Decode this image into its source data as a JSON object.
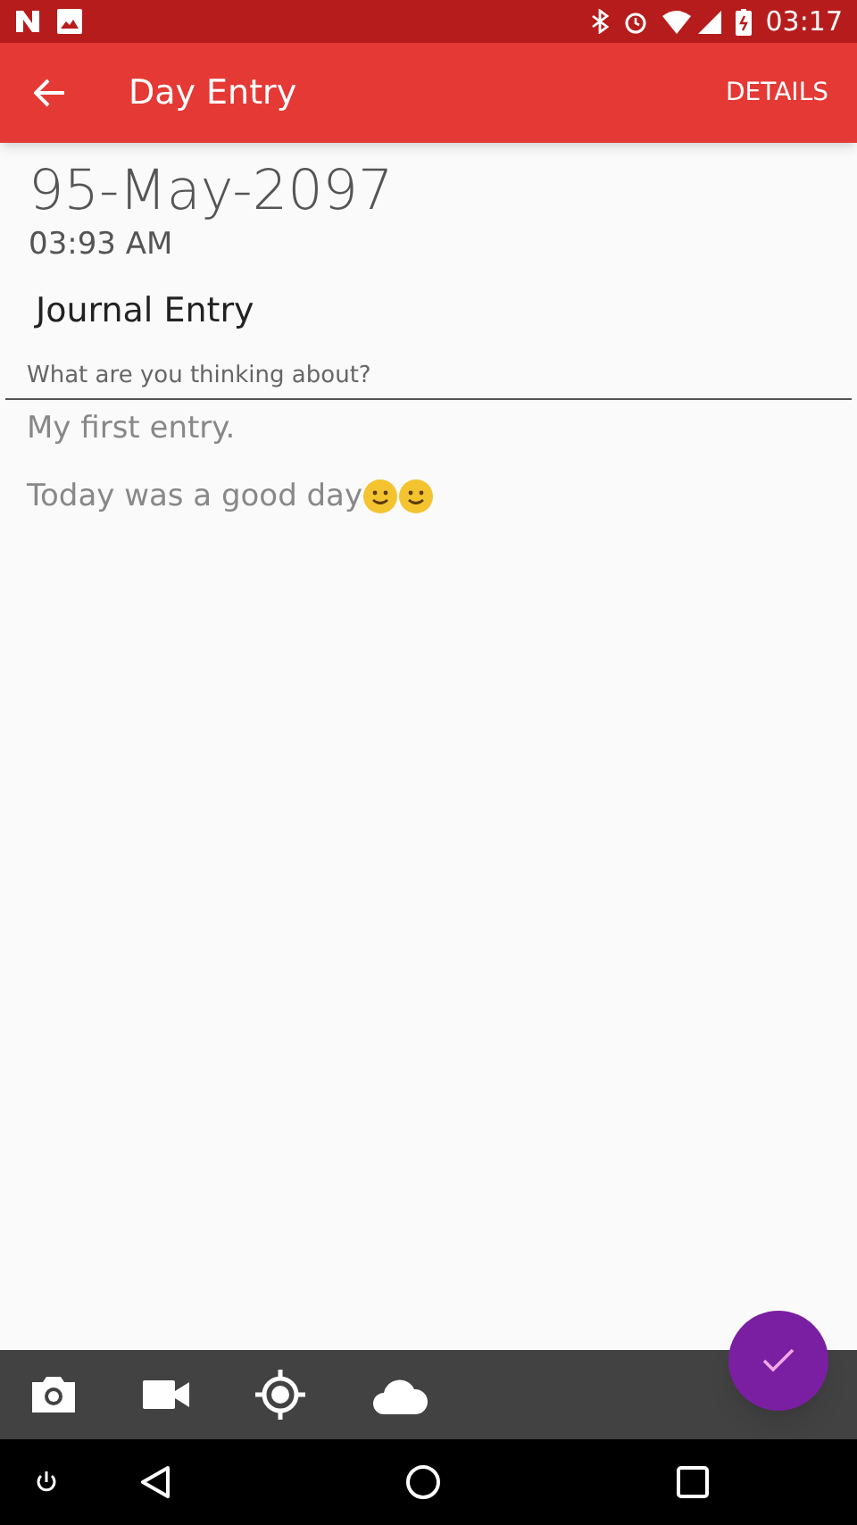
{
  "status_bar": {
    "time": "03:17"
  },
  "app_bar": {
    "title": "Day Entry",
    "action": "DETAILS"
  },
  "entry": {
    "date": "95-May-2097",
    "time": "03:93 AM",
    "title": "Journal Entry",
    "field": {
      "label": "What are you thinking about?",
      "lines": [
        [
          {
            "kind": "text",
            "text": "My first entry."
          }
        ],
        [
          {
            "kind": "text",
            "text": "Today was a good day"
          },
          {
            "kind": "smiley"
          },
          {
            "kind": "smiley"
          }
        ]
      ]
    }
  }
}
